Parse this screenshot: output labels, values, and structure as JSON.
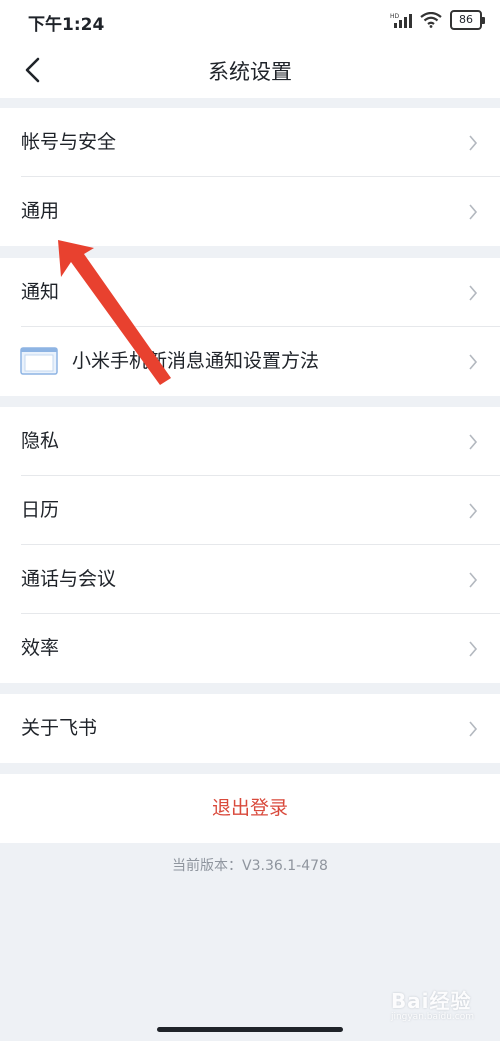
{
  "status_bar": {
    "time": "下午1:24",
    "network_label": "HD",
    "battery": "86",
    "icons": [
      "signal-icon",
      "wifi-icon",
      "battery-icon"
    ]
  },
  "nav": {
    "title": "系统设置",
    "back_icon": "back-chevron-icon"
  },
  "groups": [
    {
      "items": [
        {
          "label": "帐号与安全"
        },
        {
          "label": "通用"
        }
      ]
    },
    {
      "items": [
        {
          "label": "通知"
        },
        {
          "label": "小米手机新消息通知设置方法",
          "icon": "phone-guide-icon"
        }
      ]
    },
    {
      "items": [
        {
          "label": "隐私"
        },
        {
          "label": "日历"
        },
        {
          "label": "通话与会议"
        },
        {
          "label": "效率"
        }
      ]
    },
    {
      "items": [
        {
          "label": "关于飞书"
        }
      ]
    }
  ],
  "logout": {
    "label": "退出登录",
    "color": "#d94a3c"
  },
  "version": "当前版本：V3.36.1-478",
  "annotation": {
    "type": "red-arrow",
    "points_to": "通用",
    "color": "#e8412f"
  },
  "watermark": {
    "text": "Bai经验",
    "subtext": "jingyan.baidu.com"
  }
}
